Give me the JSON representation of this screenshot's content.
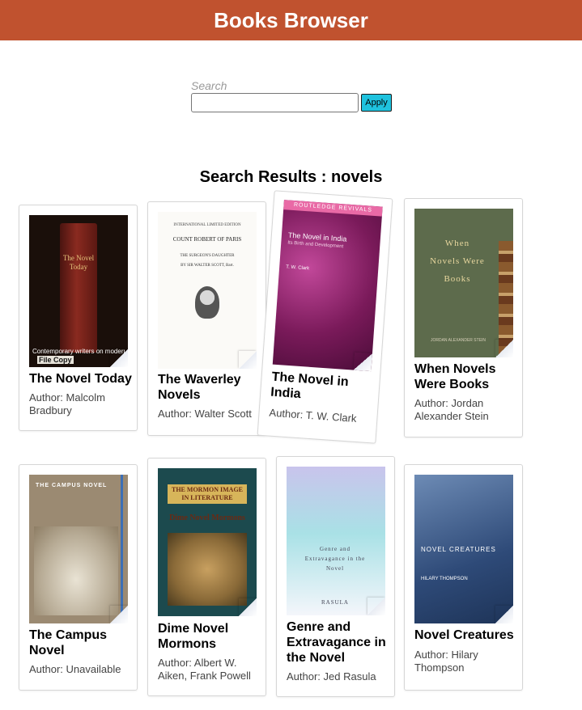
{
  "header": {
    "title": "Books Browser"
  },
  "search": {
    "label": "Search",
    "value": "",
    "placeholder": "",
    "apply_label": "Apply"
  },
  "results": {
    "title": "Search Results : novels",
    "books": [
      {
        "title": "The Novel Today",
        "author": "Author: Malcolm Bradbury",
        "cover": {
          "title": "The Novel Today",
          "caption": "Contemporary writers on modern fiction",
          "stamp": "File Copy"
        }
      },
      {
        "title": "The Waverley Novels",
        "author": "Author: Walter Scott",
        "cover": {
          "line1": "INTERNATIONAL LIMITED EDITION",
          "line2": "COUNT ROBERT OF PARIS",
          "line3": "THE SURGEON'S DAUGHTER",
          "line4": "BY SIR WALTER SCOTT, Bart."
        }
      },
      {
        "title": "The Novel in India",
        "author": "Author: T. W. Clark",
        "cover": {
          "band": "ROUTLEDGE REVIVALS",
          "title": "The Novel in India",
          "subtitle": "Its Birth and Development",
          "editor": "T. W. Clark"
        }
      },
      {
        "title": "When Novels Were Books",
        "author": "Author: Jordan Alexander Stein",
        "cover": {
          "title": "When Novels Were Books",
          "author": "JORDAN ALEXANDER STEIN"
        }
      },
      {
        "title": "The Campus Novel",
        "author": "Author: Unavailable",
        "cover": {
          "title": "THE CAMPUS NOVEL"
        }
      },
      {
        "title": "Dime Novel Mormons",
        "author": "Author: Albert W. Aiken, Frank Powell",
        "cover": {
          "top": "THE MORMON IMAGE IN LITERATURE",
          "title": "Dime Novel Mormons"
        }
      },
      {
        "title": "Genre and Extravagance in the Novel",
        "author": "Author: Jed Rasula",
        "cover": {
          "title": "Genre and Extravagance in the Novel",
          "author": "RASULA"
        }
      },
      {
        "title": "Novel Creatures",
        "author": "Author: Hilary Thompson",
        "cover": {
          "title": "NOVEL CREATURES",
          "author": "HILARY THOMPSON"
        }
      }
    ]
  }
}
